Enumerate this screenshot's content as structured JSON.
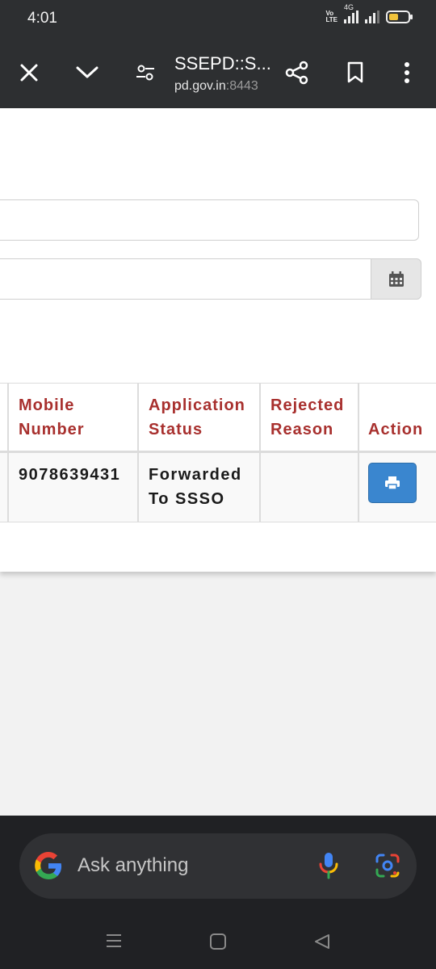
{
  "status_bar": {
    "time": "4:01",
    "volte": "Vo LTE",
    "network": "4G"
  },
  "toolbar": {
    "title": "SSEPD::S...",
    "url_host": "pd.gov.in",
    "url_port": ":8443"
  },
  "table": {
    "headers": [
      {
        "line1": "Mobile",
        "line2": "Number"
      },
      {
        "line1": "Application",
        "line2": "Status"
      },
      {
        "line1": "Rejected",
        "line2": "Reason"
      },
      {
        "line1": "",
        "line2": "Action"
      }
    ],
    "rows": [
      {
        "mobile": "9078639431",
        "status_line1": "Forwarded",
        "status_line2": "To SSSO",
        "reason": ""
      }
    ]
  },
  "search_bar": {
    "placeholder": "Ask anything"
  },
  "icons": {
    "close": "close-icon",
    "collapse": "chevron-down-icon",
    "tune": "tune-icon",
    "share": "share-icon",
    "bookmark": "bookmark-icon",
    "more": "more-vert-icon",
    "calendar": "calendar-icon",
    "print": "print-icon",
    "google": "google-logo-icon",
    "mic": "mic-icon",
    "lens": "lens-icon"
  },
  "colors": {
    "header_text": "#a8302e",
    "print_button": "#3a86cf",
    "toolbar_bg": "#2d2f31"
  }
}
